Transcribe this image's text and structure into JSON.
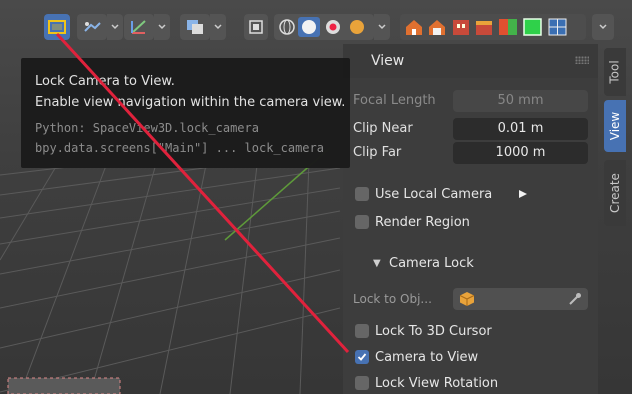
{
  "panel": {
    "title": "View",
    "focal_length_label": "Focal Length",
    "focal_length_value": "50 mm",
    "clip_near_label": "Clip Near",
    "clip_near_value": "0.01 m",
    "clip_far_label": "Clip Far",
    "clip_far_value": "1000 m",
    "use_local_camera_label": "Use Local Camera",
    "render_region_label": "Render Region",
    "camera_lock_title": "Camera Lock",
    "lock_to_object_label": "Lock to Obj...",
    "lock_to_3d_cursor_label": "Lock To 3D Cursor",
    "camera_to_view_label": "Camera to View",
    "lock_view_rotation_label": "Lock View Rotation"
  },
  "tabs": {
    "tool": "Tool",
    "view": "View",
    "create": "Create"
  },
  "tooltip": {
    "title": "Lock Camera to View.",
    "description": "Enable view navigation within the camera view.",
    "python": "Python: SpaceView3D.lock_camera",
    "bpy": "bpy.data.screens[\"Main\"] ... lock_camera"
  },
  "colors": {
    "accent": "#4772b3",
    "annotation_arrow": "#e0223c",
    "highlight_yellow": "#f0c419"
  },
  "icons": {
    "header": [
      "lock-camera-icon",
      "view-pan-icon",
      "gizmo-icon",
      "overlay-icon",
      "xray-icon",
      "wireframe-shading-icon",
      "solid-shading-icon",
      "material-shading-icon",
      "rendered-shading-icon",
      "collection-visibility-icons"
    ]
  }
}
